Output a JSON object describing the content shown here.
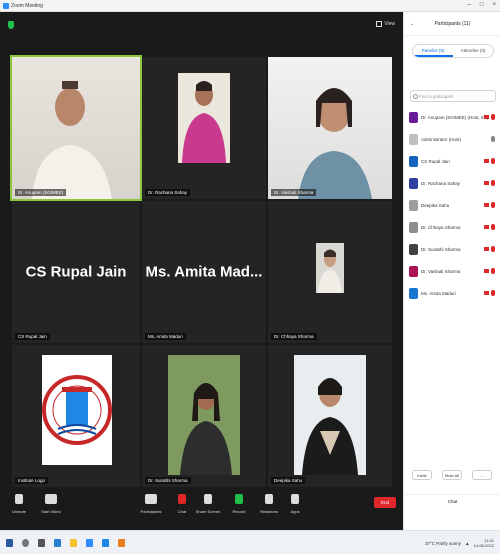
{
  "titlebar": {
    "title": "Zoom Meeting",
    "min": "–",
    "max": "□",
    "close": "×"
  },
  "meeting": {
    "view_label": "View",
    "tiles": [
      {
        "name": "Dr. Anupam (SGIMEE)",
        "type": "video",
        "active": true
      },
      {
        "name": "Dr. Rachana Sahay",
        "type": "video"
      },
      {
        "name": "Dr. Vaishali Sharma",
        "type": "video"
      },
      {
        "name": "CS Rupal Jain",
        "type": "name",
        "display": "CS Rupal Jain"
      },
      {
        "name": "Ms. Amita Maduri",
        "type": "name",
        "display": "Ms. Amita Mad..."
      },
      {
        "name": "Dr. Chhaya Sharma",
        "type": "photo"
      },
      {
        "name": "Institute Logo",
        "type": "logo"
      },
      {
        "name": "Dr. Surabhi Sharma",
        "type": "video"
      },
      {
        "name": "Deepika Sahu",
        "type": "photo"
      }
    ]
  },
  "toolbar": {
    "items": [
      {
        "label": "Unmute",
        "icon": "microphone-icon"
      },
      {
        "label": "Start Video",
        "icon": "video-camera-icon"
      },
      {
        "label": "Participants",
        "icon": "participants-icon"
      },
      {
        "label": "Chat",
        "icon": "chat-icon"
      },
      {
        "label": "Share Screen",
        "icon": "share-screen-icon"
      },
      {
        "label": "Record",
        "icon": "record-icon"
      },
      {
        "label": "Reactions",
        "icon": "reactions-icon"
      },
      {
        "label": "Apps",
        "icon": "apps-icon"
      }
    ],
    "end_label": "End"
  },
  "panel": {
    "title": "Participants (11)",
    "tabs": [
      "Panelist (9)",
      "Attendee (0)"
    ],
    "search_placeholder": "Find a participant",
    "participants": [
      {
        "name": "Dr. Anupam (SGIMEE) (Host, me)",
        "color": "#6a1b9a",
        "mic": "muted"
      },
      {
        "name": "Administrator (Host)",
        "color": "#c0c0c0",
        "mic": "on"
      },
      {
        "name": "CS Rupal Jain",
        "color": "#1565c0",
        "mic": "muted"
      },
      {
        "name": "Dr. Rachana Sahay",
        "color": "#303f9f",
        "mic": "muted"
      },
      {
        "name": "Deepika Sahu",
        "color": "#9e9e9e",
        "mic": "muted"
      },
      {
        "name": "Dr. Chhaya Sharma",
        "color": "#8d8d8d",
        "mic": "muted"
      },
      {
        "name": "Dr. Surabhi Sharma",
        "color": "#424242",
        "mic": "muted"
      },
      {
        "name": "Dr. Vaishali Sharma",
        "color": "#ad1457",
        "mic": "muted"
      },
      {
        "name": "Ms. Amita Maduri",
        "color": "#1976d2",
        "mic": "muted"
      }
    ],
    "footer_buttons": [
      "Invite",
      "Mute All",
      "..."
    ],
    "chat_label": "Chat"
  },
  "taskbar": {
    "weather": "37°C Partly sunny",
    "time": "11:31",
    "date": "14-05-2022"
  }
}
